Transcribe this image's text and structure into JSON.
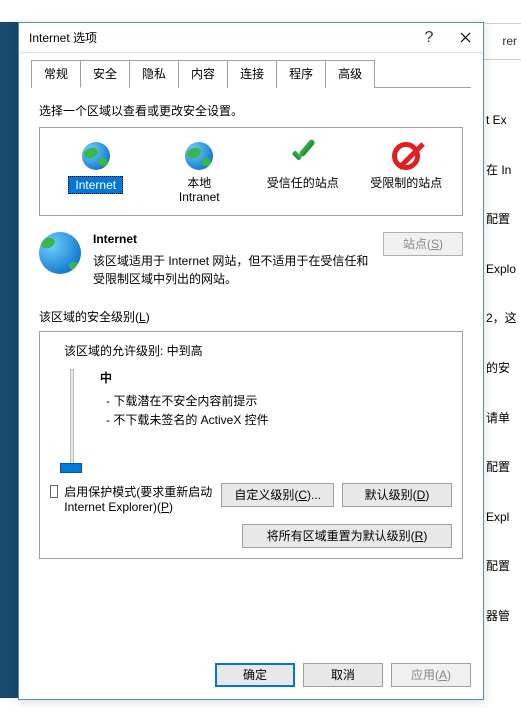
{
  "bg": {
    "bar_word": "rer",
    "lines": [
      "t Ex",
      "在 In",
      "配置",
      "Explo",
      "2，这",
      "的安",
      "请单",
      "配置",
      "Expl",
      "配置",
      "器管"
    ]
  },
  "dialog": {
    "title": "Internet 选项",
    "help": "?",
    "tabs": [
      "常规",
      "安全",
      "隐私",
      "内容",
      "连接",
      "程序",
      "高级"
    ],
    "active_tab_index": 1,
    "zone_prompt": "选择一个区域以查看或更改安全设置。",
    "zones": [
      {
        "label": "Internet"
      },
      {
        "label": "本地\nIntranet"
      },
      {
        "label": "受信任的站点"
      },
      {
        "label": "受限制的站点"
      }
    ],
    "selected_zone_index": 0,
    "sites_button": "站点(S)",
    "zone_detail": {
      "name": "Internet",
      "desc": "该区域适用于 Internet 网站，但不适用于在受信任和受限制区域中列出的网站。"
    },
    "level_section_label": "该区域的安全级别(L)",
    "allowed_levels_label": "该区域的允许级别: 中到高",
    "current_level": "中",
    "level_desc": [
      "- 下载潜在不安全内容前提示",
      "- 不下载未签名的 ActiveX 控件"
    ],
    "protected_mode_label": "启用保护模式(要求重新启动 Internet Explorer)(P)",
    "protected_mode_checked": false,
    "custom_level_button": "自定义级别(C)...",
    "default_level_button": "默认级别(D)",
    "reset_all_button": "将所有区域重置为默认级别(R)",
    "footer": {
      "ok": "确定",
      "cancel": "取消",
      "apply": "应用(A)"
    }
  }
}
